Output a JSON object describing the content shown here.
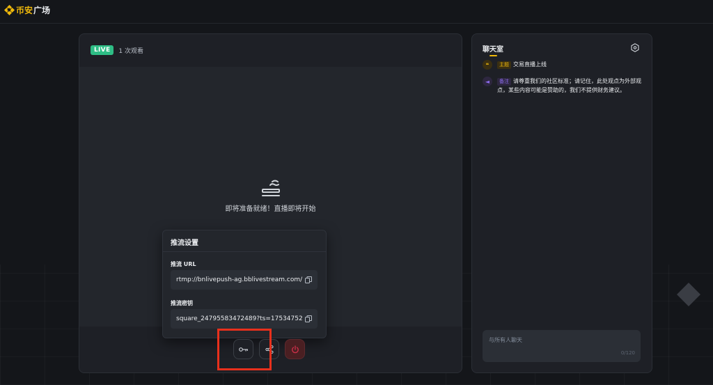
{
  "header": {
    "brand_primary": "币安",
    "brand_secondary": "广场",
    "brand_color": "#f0b90b"
  },
  "stream": {
    "live_label": "LIVE",
    "viewer_count": "1 次观看",
    "standby_text": "即将准备就绪！直播即将开始",
    "live_color": "#2ebd85"
  },
  "push_settings": {
    "title": "推流设置",
    "url_label": "推流 URL",
    "url_value": "rtmp://bnlivepush-ag.bblivestream.com/",
    "key_label": "推流密钥",
    "key_value": "square_24795583472489?ts=17534752"
  },
  "controls": {
    "key_icon": "key-icon",
    "share_icon": "share-icon",
    "power_icon": "power-icon",
    "power_color": "#cf304a"
  },
  "chat": {
    "title": "聊天室",
    "messages": [
      {
        "tag": "主题",
        "text": "交易直播上线",
        "tag_color": "#f0b90b"
      },
      {
        "tag": "备注",
        "text": "请尊重我们的社区标准；请记住，此处观点为外部观点，某些内容可能是赞助的，我们不提供财务建议。",
        "tag_color": "#8d6cf0"
      }
    ],
    "input_placeholder": "与所有人聊天",
    "char_count": "0/120"
  }
}
